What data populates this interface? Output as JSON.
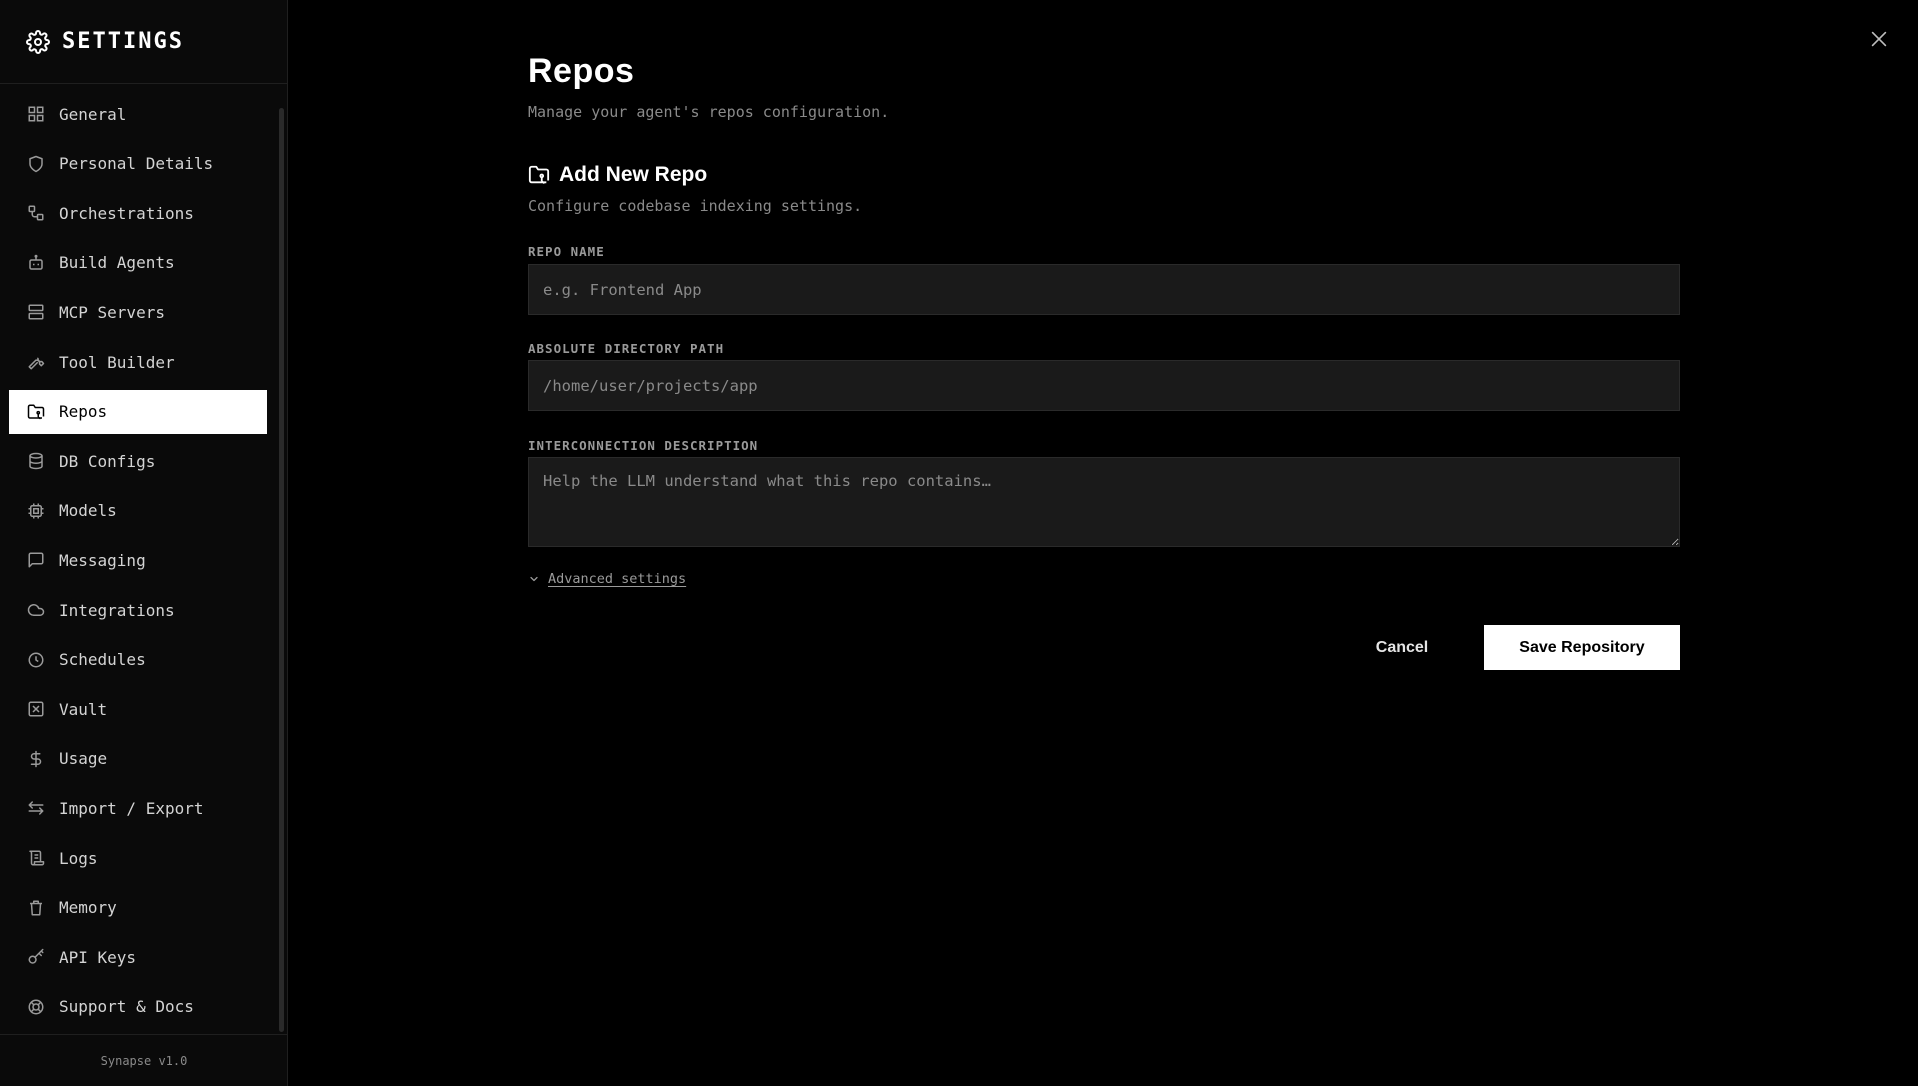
{
  "sidebar": {
    "title": "SETTINGS",
    "icon": "gear-icon",
    "footer": "Synapse v1.0",
    "active_color": "#ffffff",
    "items": [
      {
        "label": "General",
        "icon": "grid-icon"
      },
      {
        "label": "Personal Details",
        "icon": "shield-icon"
      },
      {
        "label": "Orchestrations",
        "icon": "workflow-icon"
      },
      {
        "label": "Build Agents",
        "icon": "bot-icon"
      },
      {
        "label": "MCP Servers",
        "icon": "server-icon"
      },
      {
        "label": "Tool Builder",
        "icon": "wrench-icon"
      },
      {
        "label": "Repos",
        "icon": "folder-git-icon",
        "active": true
      },
      {
        "label": "DB Configs",
        "icon": "database-icon"
      },
      {
        "label": "Models",
        "icon": "cpu-icon"
      },
      {
        "label": "Messaging",
        "icon": "message-icon"
      },
      {
        "label": "Integrations",
        "icon": "cloud-icon"
      },
      {
        "label": "Schedules",
        "icon": "clock-icon"
      },
      {
        "label": "Vault",
        "icon": "vault-icon"
      },
      {
        "label": "Usage",
        "icon": "dollar-icon"
      },
      {
        "label": "Import / Export",
        "icon": "arrows-icon"
      },
      {
        "label": "Logs",
        "icon": "scroll-icon"
      },
      {
        "label": "Memory",
        "icon": "memory-icon"
      },
      {
        "label": "API Keys",
        "icon": "key-icon"
      },
      {
        "label": "Support & Docs",
        "icon": "lifebuoy-icon"
      }
    ]
  },
  "main": {
    "title": "Repos",
    "subtitle": "Manage your agent's repos configuration.",
    "section": {
      "title": "Add New Repo",
      "icon": "folder-git-icon",
      "subtitle": "Configure codebase indexing settings."
    },
    "fields": {
      "repo_name": {
        "label": "REPO NAME",
        "placeholder": "e.g. Frontend App",
        "value": ""
      },
      "directory_path": {
        "label": "ABSOLUTE DIRECTORY PATH",
        "placeholder": "/home/user/projects/app",
        "value": ""
      },
      "description": {
        "label": "INTERCONNECTION DESCRIPTION",
        "placeholder": "Help the LLM understand what this repo contains…",
        "value": ""
      }
    },
    "advanced_label": "Advanced settings",
    "cancel_label": "Cancel",
    "save_label": "Save Repository"
  }
}
